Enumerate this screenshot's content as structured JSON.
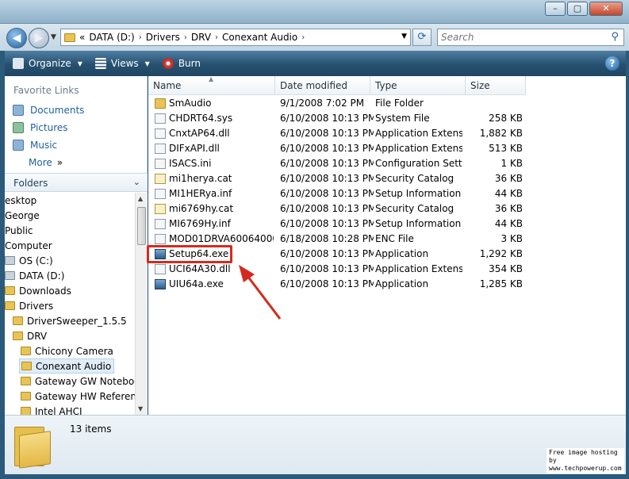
{
  "window": {
    "minimize": "–",
    "maximize": "▢",
    "close": "✕"
  },
  "address": {
    "overflow": "«",
    "crumbs": [
      "DATA (D:)",
      "Drivers",
      "DRV",
      "Conexant Audio"
    ],
    "separator": "›",
    "search_placeholder": "Search"
  },
  "toolbar": {
    "organize": "Organize",
    "views": "Views",
    "burn": "Burn",
    "help": "?"
  },
  "favorites": {
    "title": "Favorite Links",
    "items": [
      "Documents",
      "Pictures",
      "Music"
    ],
    "more": "More",
    "more_chev": "»"
  },
  "folders": {
    "title": "Folders",
    "tree": [
      {
        "label": "esktop"
      },
      {
        "label": "George"
      },
      {
        "label": "Public"
      },
      {
        "label": "Computer"
      },
      {
        "label": "OS (C:)"
      },
      {
        "label": "DATA (D:)"
      },
      {
        "label": "Downloads"
      },
      {
        "label": "Drivers"
      },
      {
        "label": "DriverSweeper_1.5.5"
      },
      {
        "label": "DRV"
      },
      {
        "label": "Chicony Camera"
      },
      {
        "label": "Conexant Audio"
      },
      {
        "label": "Gateway GW Noteboo"
      },
      {
        "label": "Gateway HW Referenc"
      },
      {
        "label": "Intel AHCI"
      }
    ]
  },
  "columns": {
    "name": "Name",
    "date": "Date modified",
    "type": "Type",
    "size": "Size"
  },
  "files": [
    {
      "name": "SmAudio",
      "date": "9/1/2008 7:02 PM",
      "type": "File Folder",
      "size": "",
      "icon": "folder"
    },
    {
      "name": "CHDRT64.sys",
      "date": "6/10/2008 10:13 PM",
      "type": "System File",
      "size": "258 KB",
      "icon": "sys"
    },
    {
      "name": "CnxtAP64.dll",
      "date": "6/10/2008 10:13 PM",
      "type": "Application Extens...",
      "size": "1,882 KB",
      "icon": "dll"
    },
    {
      "name": "DIFxAPI.dll",
      "date": "6/10/2008 10:13 PM",
      "type": "Application Extens...",
      "size": "513 KB",
      "icon": "dll"
    },
    {
      "name": "ISACS.ini",
      "date": "6/10/2008 10:13 PM",
      "type": "Configuration Sett...",
      "size": "1 KB",
      "icon": "ini"
    },
    {
      "name": "mi1herya.cat",
      "date": "6/10/2008 10:13 PM",
      "type": "Security Catalog",
      "size": "36 KB",
      "icon": "cat"
    },
    {
      "name": "MI1HERya.inf",
      "date": "6/10/2008 10:13 PM",
      "type": "Setup Information",
      "size": "44 KB",
      "icon": "inf"
    },
    {
      "name": "mi6769hy.cat",
      "date": "6/10/2008 10:13 PM",
      "type": "Security Catalog",
      "size": "36 KB",
      "icon": "cat"
    },
    {
      "name": "MI6769Hy.inf",
      "date": "6/10/2008 10:13 PM",
      "type": "Setup Information",
      "size": "44 KB",
      "icon": "inf"
    },
    {
      "name": "MOD01DRVA60064000...",
      "date": "6/18/2008 10:28 PM",
      "type": "ENC File",
      "size": "3 KB",
      "icon": "enc"
    },
    {
      "name": "Setup64.exe",
      "date": "6/10/2008 10:13 PM",
      "type": "Application",
      "size": "1,292 KB",
      "icon": "exe"
    },
    {
      "name": "UCI64A30.dll",
      "date": "6/10/2008 10:13 PM",
      "type": "Application Extens...",
      "size": "354 KB",
      "icon": "dll"
    },
    {
      "name": "UIU64a.exe",
      "date": "6/10/2008 10:13 PM",
      "type": "Application",
      "size": "1,285 KB",
      "icon": "exe"
    }
  ],
  "details": {
    "count": "13 items"
  },
  "watermark": {
    "line1": "Free image hosting by",
    "line2": "www.techpowerup.com"
  },
  "colors": {
    "annotation": "#d42a1e",
    "link": "#1f5f9e"
  }
}
